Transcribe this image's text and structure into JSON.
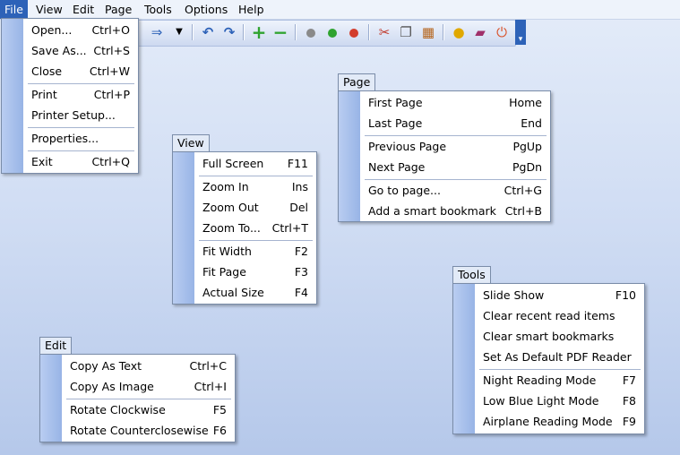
{
  "menubar": {
    "file": "File",
    "view": "View",
    "edit": "Edit",
    "page": "Page",
    "tools": "Tools",
    "options": "Options",
    "help": "Help"
  },
  "toolbar": {
    "icons": [
      "forward-arrow-icon",
      "dropdown-arrow-icon",
      "undo-icon",
      "redo-icon",
      "zoom-in-plus-icon",
      "zoom-out-minus-icon",
      "gray-dot-icon",
      "green-dot-icon",
      "red-dot-icon",
      "scissors-icon",
      "copy-icon",
      "chart-icon",
      "lightbulb-icon",
      "book-icon",
      "power-icon"
    ],
    "colors": {
      "accent": "#2d62b8",
      "green": "#2fa32f",
      "red": "#d33d2c"
    }
  },
  "file_menu": {
    "items": [
      {
        "label": "Open...",
        "shortcut": "Ctrl+O"
      },
      {
        "label": "Save As...",
        "shortcut": "Ctrl+S"
      },
      {
        "label": "Close",
        "shortcut": "Ctrl+W"
      },
      {
        "label": "Print",
        "shortcut": "Ctrl+P"
      },
      {
        "label": "Printer Setup...",
        "shortcut": ""
      },
      {
        "label": "Properties...",
        "shortcut": ""
      },
      {
        "label": "Exit",
        "shortcut": "Ctrl+Q"
      }
    ]
  },
  "view_menu": {
    "title": "View",
    "items": [
      {
        "label": "Full Screen",
        "shortcut": "F11"
      },
      {
        "label": "Zoom In",
        "shortcut": "Ins"
      },
      {
        "label": "Zoom Out",
        "shortcut": "Del"
      },
      {
        "label": "Zoom To...",
        "shortcut": "Ctrl+T"
      },
      {
        "label": "Fit Width",
        "shortcut": "F2"
      },
      {
        "label": "Fit Page",
        "shortcut": "F3"
      },
      {
        "label": "Actual Size",
        "shortcut": "F4"
      }
    ]
  },
  "page_menu": {
    "title": "Page",
    "items": [
      {
        "label": "First Page",
        "shortcut": "Home"
      },
      {
        "label": "Last Page",
        "shortcut": "End"
      },
      {
        "label": "Previous Page",
        "shortcut": "PgUp"
      },
      {
        "label": "Next Page",
        "shortcut": "PgDn"
      },
      {
        "label": "Go to page...",
        "shortcut": "Ctrl+G"
      },
      {
        "label": "Add a smart bookmark",
        "shortcut": "Ctrl+B"
      }
    ]
  },
  "tools_menu": {
    "title": "Tools",
    "items": [
      {
        "label": "Slide Show",
        "shortcut": "F10"
      },
      {
        "label": "Clear recent read items",
        "shortcut": ""
      },
      {
        "label": "Clear smart bookmarks",
        "shortcut": ""
      },
      {
        "label": "Set As Default PDF Reader",
        "shortcut": ""
      },
      {
        "label": "Night Reading Mode",
        "shortcut": "F7"
      },
      {
        "label": "Low Blue Light Mode",
        "shortcut": "F8"
      },
      {
        "label": "Airplane Reading Mode",
        "shortcut": "F9"
      }
    ]
  },
  "edit_menu": {
    "title": "Edit",
    "items": [
      {
        "label": "Copy As Text",
        "shortcut": "Ctrl+C"
      },
      {
        "label": "Copy As Image",
        "shortcut": "Ctrl+I"
      },
      {
        "label": "Rotate Clockwise",
        "shortcut": "F5"
      },
      {
        "label": "Rotate Counterclosewise",
        "shortcut": "F6"
      }
    ]
  }
}
